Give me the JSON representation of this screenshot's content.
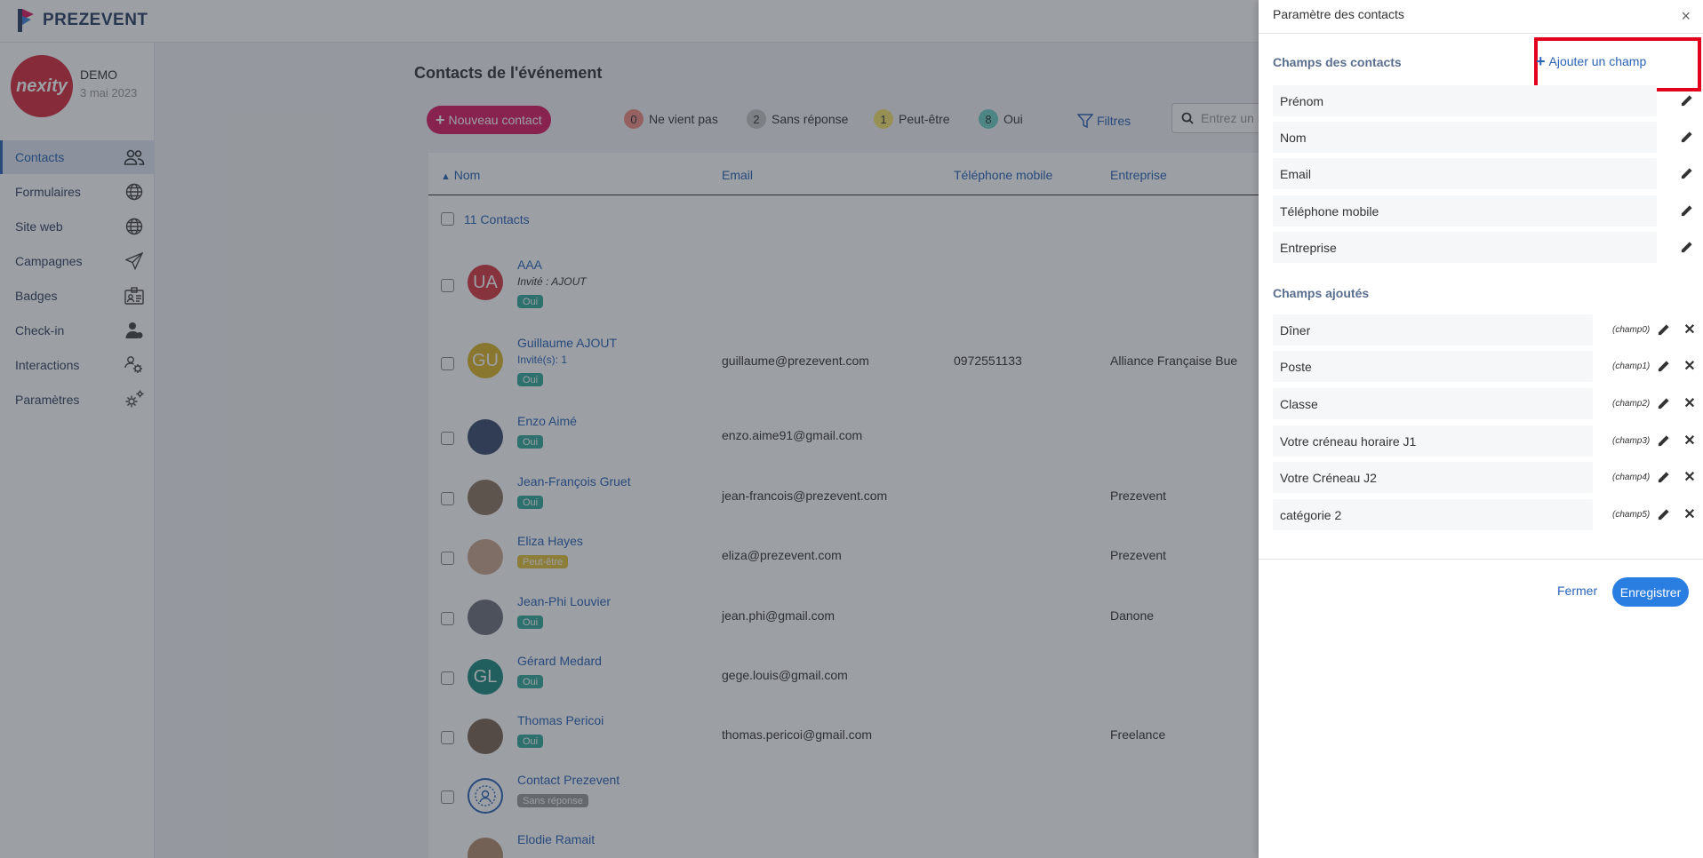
{
  "app": {
    "brand": "PREZEVENT"
  },
  "event": {
    "logo_text": "nexity",
    "name": "DEMO",
    "date": "3 mai 2023"
  },
  "sidebar": {
    "items": [
      {
        "label": "Contacts",
        "icon": "users-icon"
      },
      {
        "label": "Formulaires",
        "icon": "globe-icon"
      },
      {
        "label": "Site web",
        "icon": "globe-icon"
      },
      {
        "label": "Campagnes",
        "icon": "paper-plane-icon"
      },
      {
        "label": "Badges",
        "icon": "id-badge-icon"
      },
      {
        "label": "Check-in",
        "icon": "user-check-icon"
      },
      {
        "label": "Interactions",
        "icon": "users-gear-icon"
      },
      {
        "label": "Paramètres",
        "icon": "gears-icon"
      }
    ]
  },
  "main": {
    "title": "Contacts de l'événement",
    "new_contact_label": "Nouveau contact",
    "status_filters": [
      {
        "count": "0",
        "label": "Ne vient pas",
        "color": "#f28b82"
      },
      {
        "count": "2",
        "label": "Sans réponse",
        "color": "#c4c4c4"
      },
      {
        "count": "1",
        "label": "Peut-être",
        "color": "#f5e46b"
      },
      {
        "count": "8",
        "label": "Oui",
        "color": "#6ed0c4"
      }
    ],
    "filters_label": "Filtres",
    "search_placeholder": "Entrez un n",
    "columns": {
      "name": "Nom",
      "email": "Email",
      "phone": "Téléphone mobile",
      "company": "Entreprise"
    },
    "contacts_count": "11 Contacts",
    "rows": [
      {
        "initials": "UA",
        "name": "AAA",
        "sub": "Invité : AJOUT",
        "status": "Oui",
        "email": "",
        "phone": "",
        "company": ""
      },
      {
        "initials": "GU",
        "name": "Guillaume AJOUT",
        "sub": "Invité(s): 1",
        "status": "Oui",
        "email": "guillaume@prezevent.com",
        "phone": "0972551133",
        "company": "Alliance Française Bue"
      },
      {
        "initials": "",
        "name": "Enzo Aimé",
        "sub": "",
        "status": "Oui",
        "email": "enzo.aime91@gmail.com",
        "phone": "",
        "company": ""
      },
      {
        "initials": "",
        "name": "Jean-François Gruet",
        "sub": "",
        "status": "Oui",
        "email": "jean-francois@prezevent.com",
        "phone": "",
        "company": "Prezevent"
      },
      {
        "initials": "",
        "name": "Eliza Hayes",
        "sub": "",
        "status": "Peut-être",
        "email": "eliza@prezevent.com",
        "phone": "",
        "company": "Prezevent"
      },
      {
        "initials": "",
        "name": "Jean-Phi Louvier",
        "sub": "",
        "status": "Oui",
        "email": "jean.phi@gmail.com",
        "phone": "",
        "company": "Danone"
      },
      {
        "initials": "GL",
        "name": "Gérard Medard",
        "sub": "",
        "status": "Oui",
        "email": "gege.louis@gmail.com",
        "phone": "",
        "company": ""
      },
      {
        "initials": "",
        "name": "Thomas Pericoi",
        "sub": "",
        "status": "Oui",
        "email": "thomas.pericoi@gmail.com",
        "phone": "",
        "company": "Freelance"
      },
      {
        "initials": "",
        "name": "Contact Prezevent",
        "sub": "",
        "status": "Sans réponse",
        "email": "",
        "phone": "",
        "company": ""
      },
      {
        "initials": "",
        "name": "Elodie Ramait",
        "sub": "",
        "status": "",
        "email": "",
        "phone": "",
        "company": ""
      }
    ]
  },
  "panel": {
    "title": "Paramètre des contacts",
    "close_icon": "×",
    "contact_fields_title": "Champs des contacts",
    "add_field_label": "Ajouter un champ",
    "contact_fields": [
      "Prénom",
      "Nom",
      "Email",
      "Téléphone mobile",
      "Entreprise"
    ],
    "added_fields_title": "Champs ajoutés",
    "added_fields": [
      {
        "label": "Dîner",
        "key": "(champ0)"
      },
      {
        "label": "Poste",
        "key": "(champ1)"
      },
      {
        "label": "Classe",
        "key": "(champ2)"
      },
      {
        "label": "Votre créneau horaire J1",
        "key": "(champ3)"
      },
      {
        "label": "Votre Créneau J2",
        "key": "(champ4)"
      },
      {
        "label": "catégorie 2",
        "key": "(champ5)"
      }
    ],
    "close_label": "Fermer",
    "save_label": "Enregistrer"
  }
}
